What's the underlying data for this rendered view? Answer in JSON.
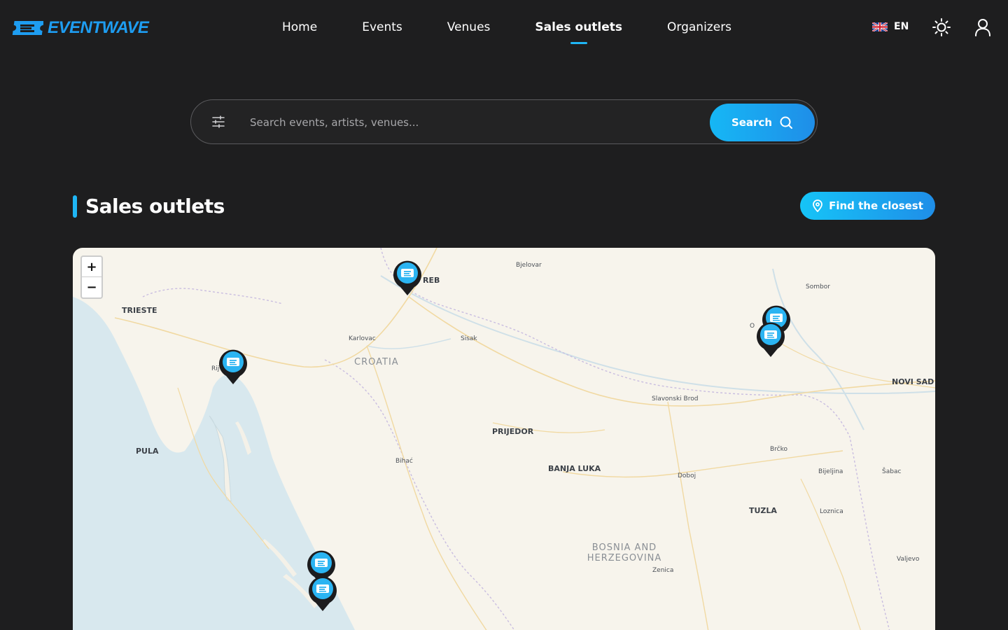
{
  "header": {
    "logo_text": "EVENTWAVE",
    "nav": [
      {
        "label": "Home",
        "active": false
      },
      {
        "label": "Events",
        "active": false
      },
      {
        "label": "Venues",
        "active": false
      },
      {
        "label": "Sales outlets",
        "active": true
      },
      {
        "label": "Organizers",
        "active": false
      }
    ],
    "language": "EN",
    "icons": {
      "language_flag": "uk-flag-icon",
      "theme": "sun-icon",
      "account": "user-icon"
    }
  },
  "search": {
    "placeholder": "Search events, artists, venues...",
    "value": "",
    "button_label": "Search",
    "icons": {
      "filter": "sliders-icon",
      "button": "search-icon"
    }
  },
  "section": {
    "title": "Sales outlets",
    "action_label": "Find the closest",
    "action_icon": "map-pin-icon"
  },
  "map": {
    "zoom_in_label": "+",
    "zoom_out_label": "−",
    "countries": [
      "CROATIA",
      "BOSNIA AND HERZEGOVINA"
    ],
    "cities": [
      "TRIESTE",
      "PULA",
      "PRIJEDOR",
      "BANJA LUKA",
      "TUZLA",
      "NOVI SAD"
    ],
    "towns": [
      "Bjelovar",
      "Karlovac",
      "Sisak",
      "Slavonski Brod",
      "Sombor",
      "Bihać",
      "Doboj",
      "Brčko",
      "Bijeljina",
      "Šabac",
      "Loznica",
      "Zenica",
      "Valjevo",
      "REB",
      "Rij",
      "O"
    ],
    "marker_icon": "ticket-icon",
    "marker_count": 6
  },
  "colors": {
    "background": "#1e1e1f",
    "accent": "#1fb6f5",
    "accent_dark": "#1f8ee8",
    "map_land": "#f7f4ec",
    "map_sea": "#d8e8ee"
  }
}
